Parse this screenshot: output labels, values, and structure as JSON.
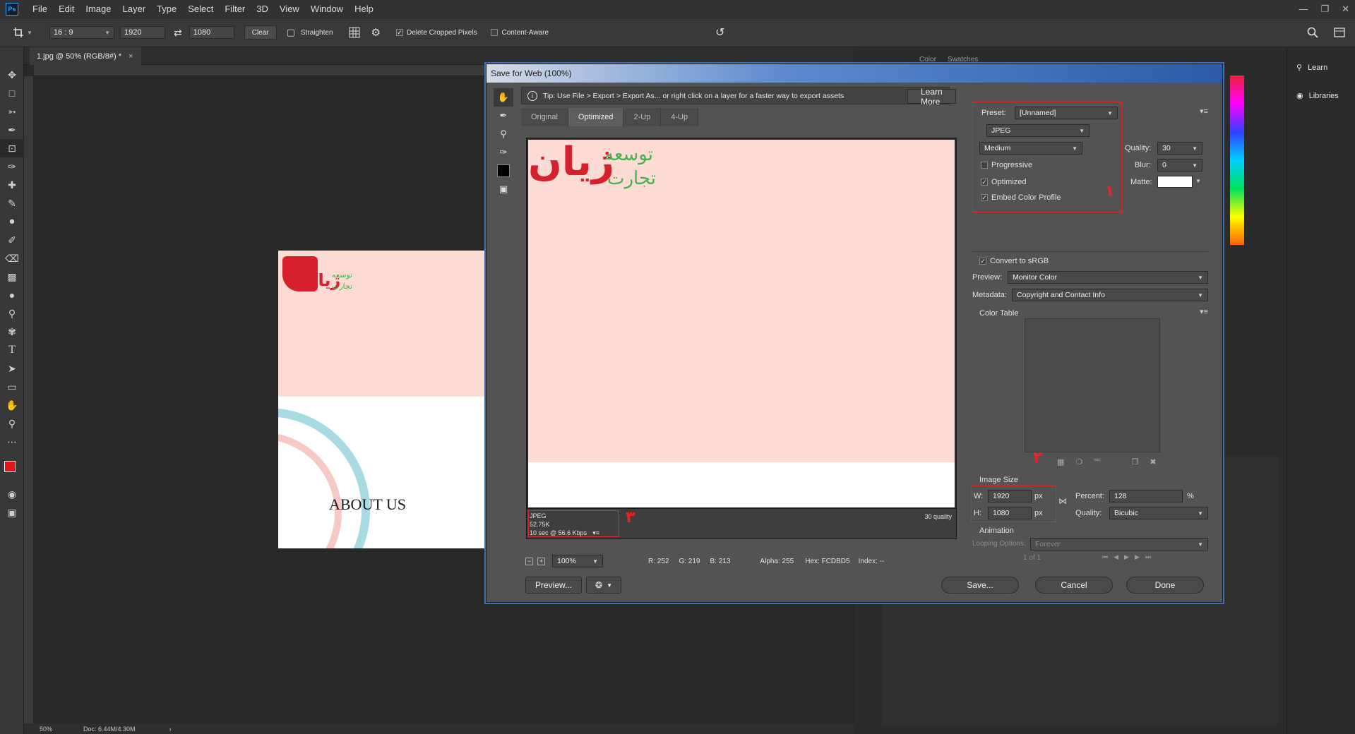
{
  "app": {
    "logo": "Ps",
    "menu": [
      "File",
      "Edit",
      "Image",
      "Layer",
      "Type",
      "Select",
      "Filter",
      "3D",
      "View",
      "Window",
      "Help"
    ]
  },
  "options_bar": {
    "ratio": "16 : 9",
    "width": "1920",
    "height": "1080",
    "clear": "Clear",
    "straighten": "Straighten",
    "delete_cropped": "Delete Cropped Pixels",
    "content_aware": "Content-Aware"
  },
  "document": {
    "tab_title": "1.jpg @ 50% (RGB/8#) *",
    "close": "×",
    "status_zoom": "50%",
    "status_doc": "Doc: 6.44M/4.30M",
    "logo_text_1": "توسعه",
    "logo_text_2": "تجارت",
    "logo_main": "ژیان",
    "about": "ABOUT US",
    "colors": {
      "bg": "#fcdbd5",
      "brand_red": "#d6202c",
      "brand_green": "#4caf50",
      "circle_blue": "#a7dbe1",
      "circle_pink": "#f6c9c5"
    }
  },
  "right_panels": {
    "learn": "Learn",
    "libraries": "Libraries",
    "color_tab": "Color",
    "swatches_tab": "Swatches"
  },
  "dialog": {
    "title": "Save for Web (100%)",
    "tip": "Tip: Use File > Export > Export As...  or right click on a layer for a faster way to export assets",
    "learn_more": "Learn More",
    "tabs": [
      "Original",
      "Optimized",
      "2-Up",
      "4-Up"
    ],
    "active_tab": "Optimized",
    "preview": {
      "logo_line_1": "توسعه",
      "logo_line_2": "تجارت",
      "logo_main": "ژیان",
      "format": "JPEG",
      "size": "52.75K",
      "speed": "10 sec @ 56.6 Kbps",
      "quality_note": "30 quality"
    },
    "zoom": "100%",
    "readout": {
      "r": "R: 252",
      "g": "G: 219",
      "b": "B: 213",
      "alpha": "Alpha: 255",
      "hex": "Hex: FCDBD5",
      "index": "Index: --"
    },
    "buttons": {
      "preview": "Preview...",
      "save": "Save...",
      "cancel": "Cancel",
      "done": "Done"
    },
    "settings": {
      "preset_label": "Preset:",
      "preset_value": "[Unnamed]",
      "format": "JPEG",
      "compression": "Medium",
      "quality_label": "Quality:",
      "quality_value": "30",
      "blur_label": "Blur:",
      "blur_value": "0",
      "matte_label": "Matte:",
      "progressive": "Progressive",
      "progressive_checked": false,
      "optimized": "Optimized",
      "optimized_checked": true,
      "embed_profile": "Embed Color Profile",
      "embed_checked": true,
      "convert_srgb": "Convert to sRGB",
      "convert_checked": true,
      "preview_label": "Preview:",
      "preview_value": "Monitor Color",
      "metadata_label": "Metadata:",
      "metadata_value": "Copyright and Contact Info",
      "color_table": "Color Table",
      "image_size": "Image Size",
      "w_label": "W:",
      "w_value": "1920",
      "h_label": "H:",
      "h_value": "1080",
      "px": "px",
      "percent_label": "Percent:",
      "percent_value": "128",
      "percent_unit": "%",
      "resample_label": "Quality:",
      "resample_value": "Bicubic",
      "animation": "Animation",
      "looping_label": "Looping Options:",
      "looping_value": "Forever",
      "frame_count": "1 of 1"
    },
    "annotations": [
      "۱",
      "۲",
      "۳"
    ]
  }
}
